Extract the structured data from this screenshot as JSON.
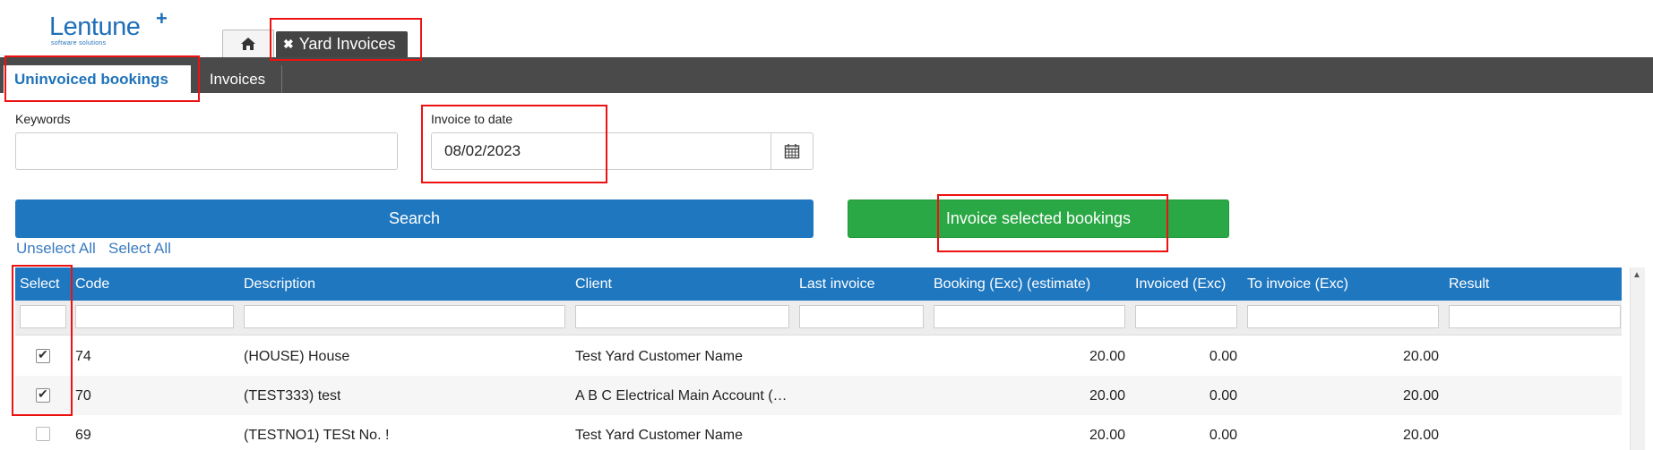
{
  "logo": {
    "name": "Lentune",
    "plus": "+",
    "tagline": "software solutions"
  },
  "top_tabs": {
    "home_icon": "home-icon",
    "active_tab": "Yard Invoices",
    "close_glyph": "✖"
  },
  "subtabs": {
    "active": "Uninvoiced bookings",
    "other": "Invoices"
  },
  "form": {
    "keywords_label": "Keywords",
    "keywords_value": "",
    "date_label": "Invoice to date",
    "date_value": "08/02/2023",
    "calendar_icon": "calendar-icon"
  },
  "buttons": {
    "search": "Search",
    "invoice": "Invoice selected bookings"
  },
  "links": {
    "unselect_all": "Unselect All",
    "select_all": "Select All"
  },
  "table": {
    "columns": [
      "Select",
      "Code",
      "Description",
      "Client",
      "Last invoice",
      "Booking (Exc) (estimate)",
      "Invoiced (Exc)",
      "To invoice (Exc)",
      "Result"
    ],
    "rows": [
      {
        "checked": true,
        "code": "74",
        "description": "(HOUSE) House",
        "client": "Test Yard Customer Name",
        "last_invoice": "",
        "booking": "20.00",
        "invoiced": "0.00",
        "to_invoice": "20.00",
        "result": ""
      },
      {
        "checked": true,
        "code": "70",
        "description": "(TEST333) test",
        "client": "A B C Electrical Main Account (…",
        "last_invoice": "",
        "booking": "20.00",
        "invoiced": "0.00",
        "to_invoice": "20.00",
        "result": ""
      },
      {
        "checked": false,
        "code": "69",
        "description": "(TESTNO1) TESt No. !",
        "client": "Test Yard Customer Name",
        "last_invoice": "",
        "booking": "20.00",
        "invoiced": "0.00",
        "to_invoice": "20.00",
        "result": ""
      }
    ]
  },
  "colors": {
    "brand": "#1f6fb8",
    "header_blue": "#1f77c0",
    "green": "#2aa845",
    "nav_dark": "#4a4a4a",
    "highlight": "#ee1111"
  }
}
